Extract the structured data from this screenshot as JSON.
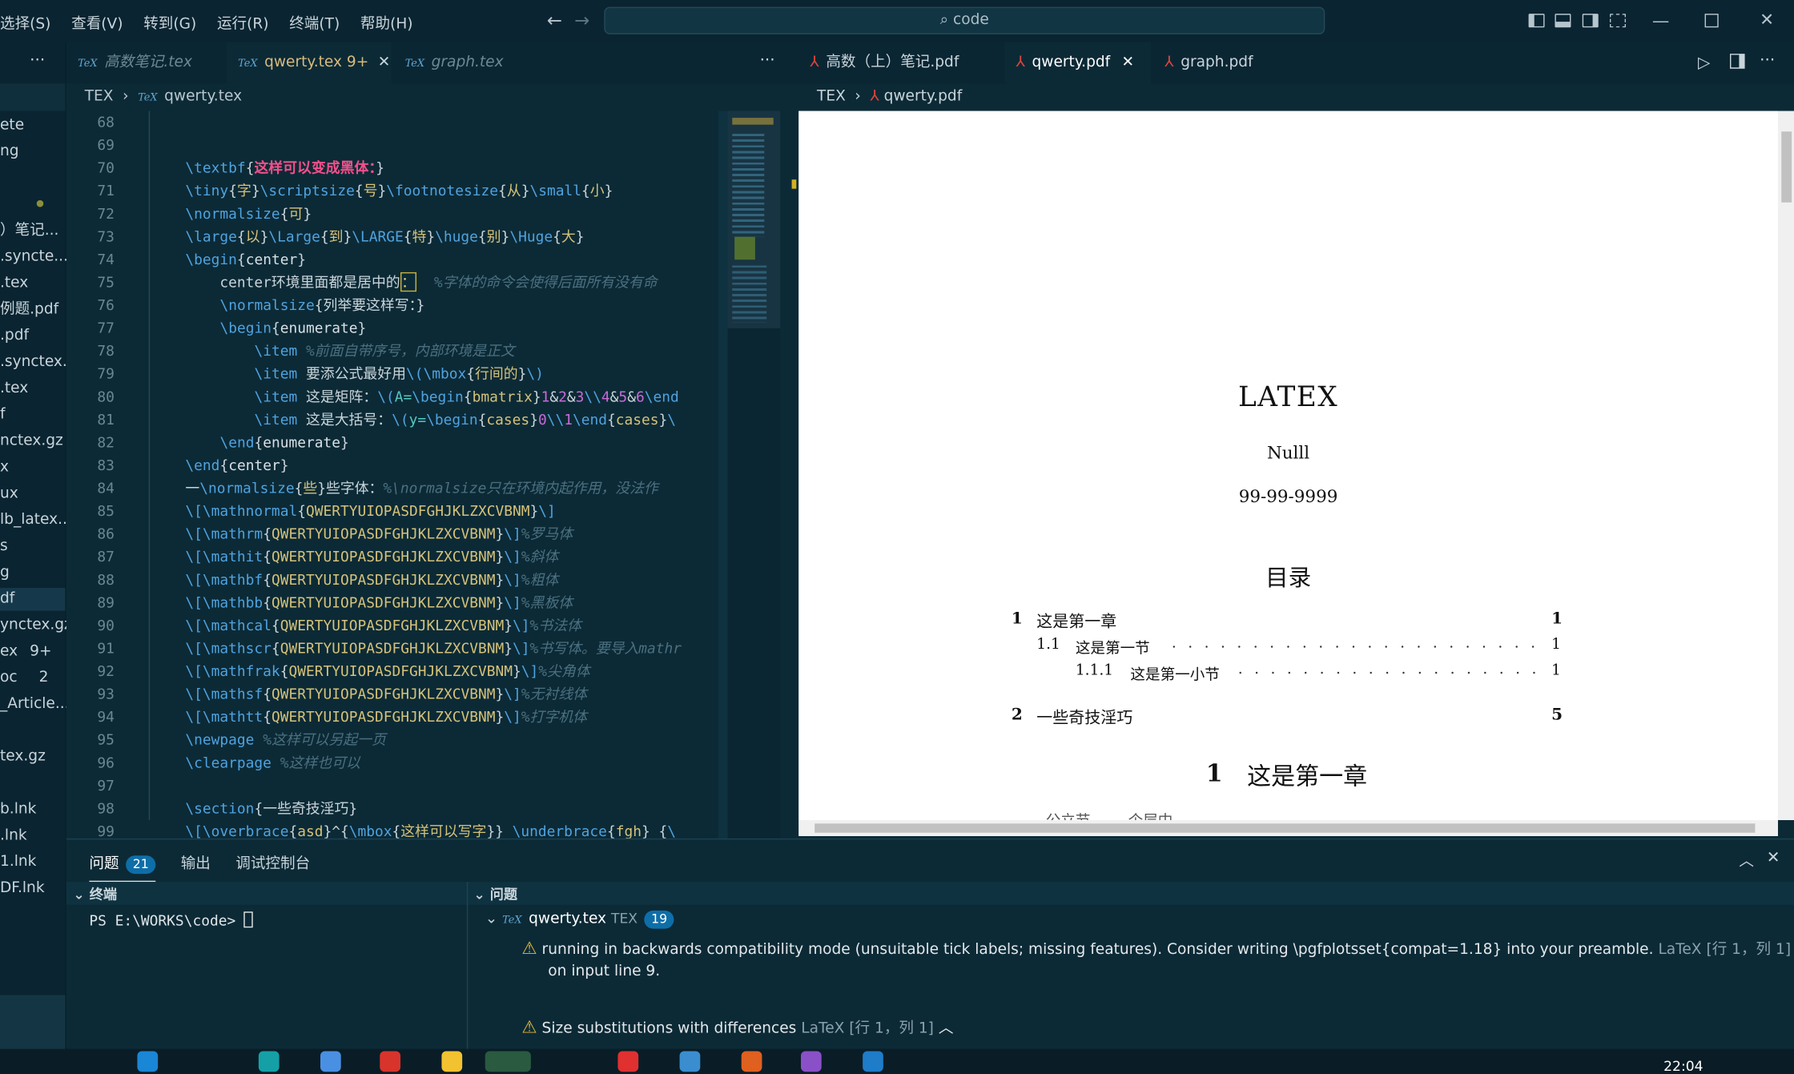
{
  "menu": [
    "选择(S)",
    "查看(V)",
    "转到(G)",
    "运行(R)",
    "终端(T)",
    "帮助(H)"
  ],
  "search": {
    "text": "code"
  },
  "sidebar": {
    "dots": "···",
    "items": [
      "ete",
      "ng",
      "）笔记...",
      ".syncte...",
      ".tex",
      "例题.pdf",
      ".pdf",
      ".synctex...",
      ".tex",
      "f",
      "nctex.gz",
      "x",
      "ux",
      "lb_latex...",
      "s",
      "g",
      "df",
      "ynctex.gz",
      "ex",
      "oc",
      "_Article...",
      "tex.gz",
      "b.lnk",
      ".lnk",
      "1.lnk",
      "DF.lnk"
    ],
    "badge1": "9+",
    "badge2": "2"
  },
  "editor_tabs": [
    {
      "label": "高数笔记.tex",
      "active": false
    },
    {
      "label": "qwerty.tex",
      "badge": "9+",
      "active": true
    },
    {
      "label": "graph.tex",
      "active": false
    }
  ],
  "editor_breadcrumb": {
    "root": "TEX",
    "file": "qwerty.tex"
  },
  "line_numbers": [
    "68",
    "69",
    "70",
    "71",
    "72",
    "73",
    "74",
    "75",
    "76",
    "77",
    "78",
    "79",
    "80",
    "81",
    "82",
    "83",
    "84",
    "85",
    "86",
    "87",
    "88",
    "89",
    "90",
    "91",
    "92",
    "93",
    "94",
    "95",
    "96",
    "97",
    "98",
    "99"
  ],
  "pdf_tabs": [
    {
      "label": "高数（上）笔记.pdf",
      "active": false
    },
    {
      "label": "qwerty.pdf",
      "active": true
    },
    {
      "label": "graph.pdf",
      "active": false
    }
  ],
  "pdf_breadcrumb": {
    "root": "TEX",
    "file": "qwerty.pdf"
  },
  "pdf": {
    "title": "LATEX",
    "author": "Nulll",
    "date": "99-99-9999",
    "toc_title": "目录",
    "toc": [
      {
        "num": "1",
        "text": "这是第一章",
        "page": "1"
      },
      {
        "num": "1.1",
        "text": "这是第一节",
        "page": "1"
      },
      {
        "num": "1.1.1",
        "text": "这是第一小节",
        "page": "1"
      },
      {
        "num": "2",
        "text": "一些奇技淫巧",
        "page": "5"
      }
    ],
    "chapter_num": "1",
    "chapter_title": "这是第一章",
    "cut_text": "公立节 ...... 个层中"
  },
  "panel": {
    "tabs": [
      {
        "label": "问题",
        "count": "21"
      },
      {
        "label": "输出"
      },
      {
        "label": "调试控制台"
      }
    ],
    "terminal_header": "终端",
    "problems_header": "问题",
    "prompt": "PS E:\\WORKS\\code>",
    "file": "qwerty.tex",
    "file_type": "TEX",
    "file_count": "19",
    "warning1": "running in backwards compatibility mode (unsuitable tick labels; missing features). Consider writing \\pgfplotsset{compat=1.18} into your preamble.",
    "warning1_src": "LaTeX",
    "warning1_loc": "[行 1，列 1]",
    "warning1_line2": "on input line 9.",
    "warning2": "Size substitutions with differences",
    "warning2_src": "LaTeX",
    "warning2_loc": "[行 1，列 1]"
  },
  "clock": "22:04"
}
